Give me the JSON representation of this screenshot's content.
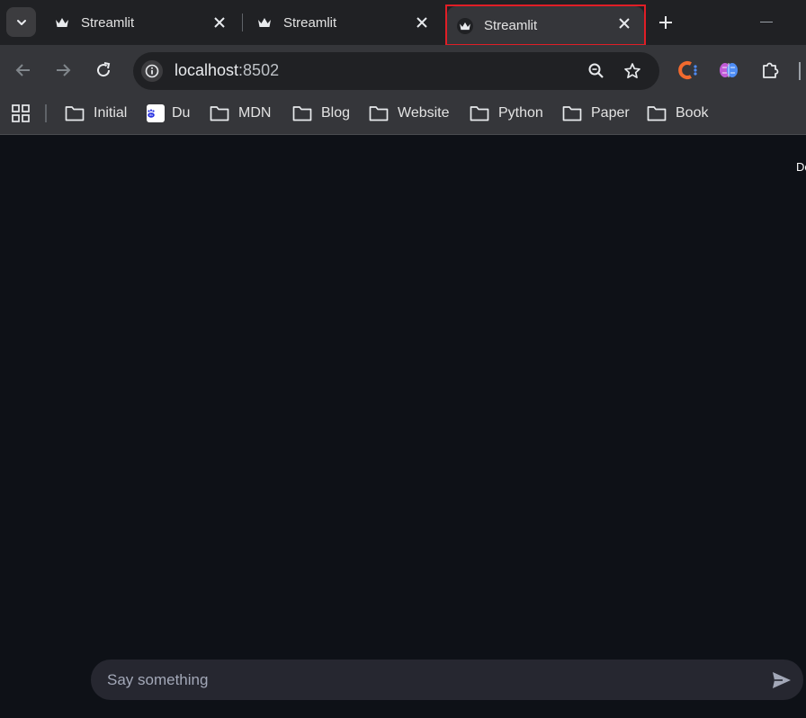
{
  "tabs": [
    {
      "title": "Streamlit"
    },
    {
      "title": "Streamlit"
    },
    {
      "title": "Streamlit"
    }
  ],
  "address_bar": {
    "host": "localhost",
    "port": ":8502"
  },
  "bookmarks": [
    {
      "label": "Initial",
      "icon": "folder-icon"
    },
    {
      "label": "Du",
      "icon": "baidu-icon"
    },
    {
      "label": "MDN",
      "icon": "folder-icon"
    },
    {
      "label": "Blog",
      "icon": "folder-icon"
    },
    {
      "label": "Website",
      "icon": "folder-icon"
    },
    {
      "label": "Python",
      "icon": "folder-icon"
    },
    {
      "label": "Paper",
      "icon": "folder-icon"
    },
    {
      "label": "Book",
      "icon": "folder-icon"
    }
  ],
  "app": {
    "deploy_label": "De",
    "chat_placeholder": "Say something"
  },
  "colors": {
    "highlight_outline": "#e01e26",
    "app_background": "#0e1117",
    "chat_input_bg": "#262730"
  }
}
